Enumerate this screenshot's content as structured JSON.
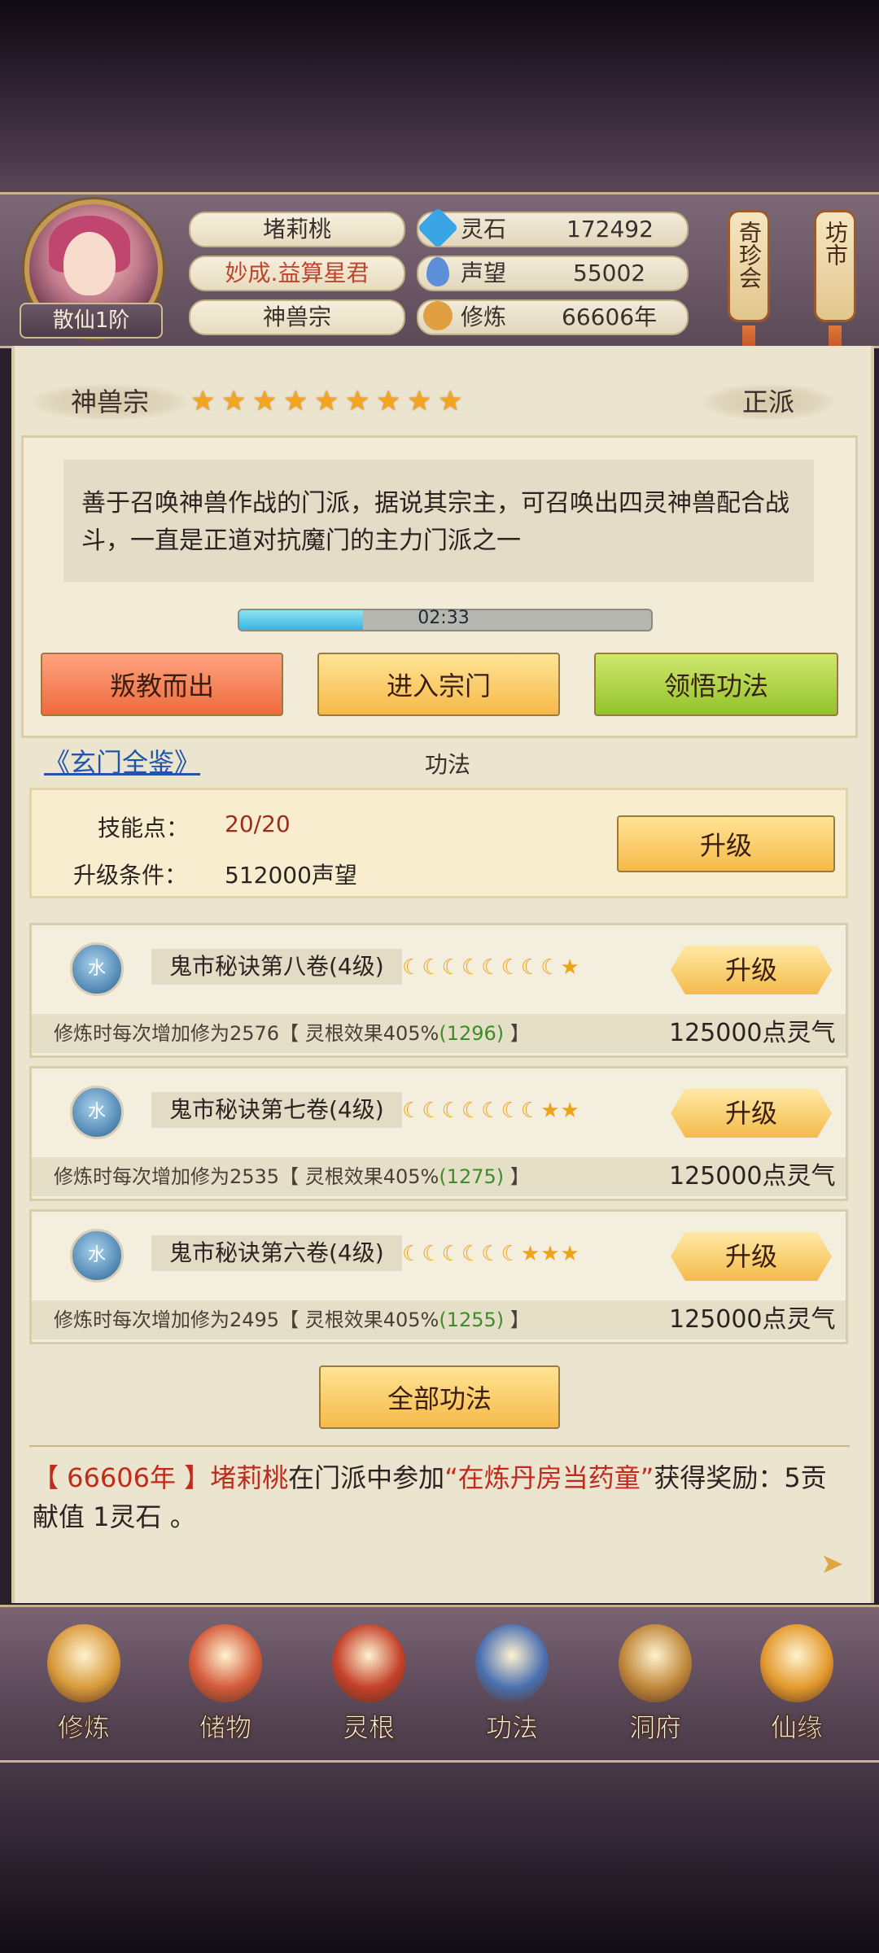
{
  "player": {
    "name": "堵莉桃",
    "title": "妙成.益算星君",
    "sect": "神兽宗",
    "rank": "散仙1阶"
  },
  "resources": [
    {
      "label": "灵石",
      "value": "172492",
      "icon": "spirit-stone-icon",
      "color": "#3aa5e5"
    },
    {
      "label": "声望",
      "value": "55002",
      "icon": "reputation-icon",
      "color": "#5c8fd8"
    },
    {
      "label": "修炼",
      "value": "66606年",
      "icon": "meditation-icon",
      "color": "#e0a040"
    }
  ],
  "side_buttons": [
    {
      "label": "奇珍会"
    },
    {
      "label": "坊市"
    }
  ],
  "sect_info": {
    "name": "神兽宗",
    "stars": 9,
    "alignment": "正派",
    "description": "善于召唤神兽作战的门派，据说其宗主，可召唤出四灵神兽配合战斗，一直是正道对抗魔门的主力门派之一",
    "timer": "02:33",
    "timer_progress": 0.3
  },
  "actions": {
    "defect": "叛教而出",
    "enter": "进入宗门",
    "comprehend": "领悟功法"
  },
  "gongfa": {
    "link": "《玄门全鉴》",
    "section_title": "功法",
    "skill_points_label": "技能点：",
    "skill_points_value": "20/20",
    "upgrade_cond_label": "升级条件：",
    "upgrade_cond_value": "512000声望",
    "upgrade_label": "升级",
    "all_label": "全部功法"
  },
  "books": [
    {
      "element": "水",
      "name": "鬼市秘诀第八卷(4级)",
      "moons": 8,
      "stars": 1,
      "detail_prefix": "修炼时每次增加修为2576【 灵根效果405%",
      "detail_green": "(1296)",
      "detail_suffix": " 】",
      "cost": "125000点灵气",
      "button": "升级"
    },
    {
      "element": "水",
      "name": "鬼市秘诀第七卷(4级)",
      "moons": 7,
      "stars": 2,
      "detail_prefix": "修炼时每次增加修为2535【 灵根效果405%",
      "detail_green": "(1275)",
      "detail_suffix": " 】",
      "cost": "125000点灵气",
      "button": "升级"
    },
    {
      "element": "水",
      "name": "鬼市秘诀第六卷(4级)",
      "moons": 6,
      "stars": 3,
      "detail_prefix": "修炼时每次增加修为2495【 灵根效果405%",
      "detail_green": "(1255)",
      "detail_suffix": " 】",
      "cost": "125000点灵气",
      "button": "升级"
    }
  ],
  "log": {
    "year": "【 66606年 】",
    "name": "堵莉桃",
    "middle": "在门派中参加",
    "event": "“在炼丹房当药童”",
    "reward": "获得奖励：5贡献值 1灵石 。"
  },
  "nav": [
    {
      "label": "修炼",
      "icon": "cultivate-icon",
      "color": "#d99a3c"
    },
    {
      "label": "储物",
      "icon": "storage-bag-icon",
      "color": "#d45a3a"
    },
    {
      "label": "灵根",
      "icon": "spirit-root-icon",
      "color": "#c4402a"
    },
    {
      "label": "功法",
      "icon": "technique-book-icon",
      "color": "#4a6fb0"
    },
    {
      "label": "洞府",
      "icon": "cave-house-icon",
      "color": "#c0873a"
    },
    {
      "label": "仙缘",
      "icon": "gourd-icon",
      "color": "#e49a2e"
    }
  ]
}
